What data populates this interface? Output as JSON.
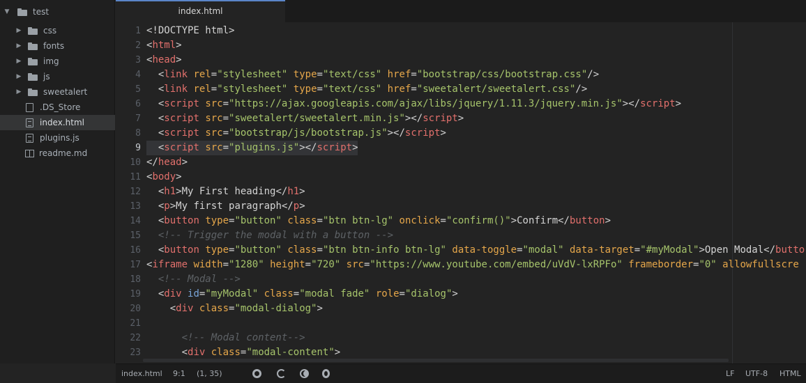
{
  "tree": {
    "root": "test",
    "folders": [
      "css",
      "fonts",
      "img",
      "js",
      "sweetalert"
    ],
    "files": [
      {
        "name": ".DS_Store",
        "selected": false
      },
      {
        "name": "index.html",
        "selected": true
      },
      {
        "name": "plugins.js",
        "selected": false
      },
      {
        "name": "readme.md",
        "selected": false
      }
    ]
  },
  "tabs": [
    {
      "label": "index.html",
      "active": true
    }
  ],
  "editor": {
    "cursor_line": 9,
    "lines": [
      [
        [
          "p",
          "<!DOCTYPE html>"
        ]
      ],
      [
        [
          "p",
          "<"
        ],
        [
          "t",
          "html"
        ],
        [
          "p",
          ">"
        ]
      ],
      [
        [
          "p",
          "<"
        ],
        [
          "t",
          "head"
        ],
        [
          "p",
          ">"
        ]
      ],
      [
        [
          "p",
          "  <"
        ],
        [
          "t",
          "link"
        ],
        [
          "p",
          " "
        ],
        [
          "a",
          "rel"
        ],
        [
          "p",
          "="
        ],
        [
          "s",
          "\"stylesheet\""
        ],
        [
          "p",
          " "
        ],
        [
          "a",
          "type"
        ],
        [
          "p",
          "="
        ],
        [
          "s",
          "\"text/css\""
        ],
        [
          "p",
          " "
        ],
        [
          "a",
          "href"
        ],
        [
          "p",
          "="
        ],
        [
          "s",
          "\"bootstrap/css/bootstrap.css\""
        ],
        [
          "p",
          "/>"
        ]
      ],
      [
        [
          "p",
          "  <"
        ],
        [
          "t",
          "link"
        ],
        [
          "p",
          " "
        ],
        [
          "a",
          "rel"
        ],
        [
          "p",
          "="
        ],
        [
          "s",
          "\"stylesheet\""
        ],
        [
          "p",
          " "
        ],
        [
          "a",
          "type"
        ],
        [
          "p",
          "="
        ],
        [
          "s",
          "\"text/css\""
        ],
        [
          "p",
          " "
        ],
        [
          "a",
          "href"
        ],
        [
          "p",
          "="
        ],
        [
          "s",
          "\"sweetalert/sweetalert.css\""
        ],
        [
          "p",
          "/>"
        ]
      ],
      [
        [
          "p",
          "  <"
        ],
        [
          "t",
          "script"
        ],
        [
          "p",
          " "
        ],
        [
          "a",
          "src"
        ],
        [
          "p",
          "="
        ],
        [
          "s",
          "\"https://ajax.googleapis.com/ajax/libs/jquery/1.11.3/jquery.min.js\""
        ],
        [
          "p",
          "></"
        ],
        [
          "t",
          "script"
        ],
        [
          "p",
          ">"
        ]
      ],
      [
        [
          "p",
          "  <"
        ],
        [
          "t",
          "script"
        ],
        [
          "p",
          " "
        ],
        [
          "a",
          "src"
        ],
        [
          "p",
          "="
        ],
        [
          "s",
          "\"sweetalert/sweetalert.min.js\""
        ],
        [
          "p",
          "></"
        ],
        [
          "t",
          "script"
        ],
        [
          "p",
          ">"
        ]
      ],
      [
        [
          "p",
          "  <"
        ],
        [
          "t",
          "script"
        ],
        [
          "p",
          " "
        ],
        [
          "a",
          "src"
        ],
        [
          "p",
          "="
        ],
        [
          "s",
          "\"bootstrap/js/bootstrap.js\""
        ],
        [
          "p",
          "></"
        ],
        [
          "t",
          "script"
        ],
        [
          "p",
          ">"
        ]
      ],
      [
        [
          "p",
          "  <"
        ],
        [
          "t",
          "script"
        ],
        [
          "p",
          " "
        ],
        [
          "a",
          "src"
        ],
        [
          "p",
          "="
        ],
        [
          "s",
          "\"plugins.js\""
        ],
        [
          "p",
          "></"
        ],
        [
          "t",
          "script"
        ],
        [
          "p",
          ">"
        ]
      ],
      [
        [
          "p",
          "</"
        ],
        [
          "t",
          "head"
        ],
        [
          "p",
          ">"
        ]
      ],
      [
        [
          "p",
          "<"
        ],
        [
          "t",
          "body"
        ],
        [
          "p",
          ">"
        ]
      ],
      [
        [
          "p",
          "  <"
        ],
        [
          "t",
          "h1"
        ],
        [
          "p",
          ">My First heading</"
        ],
        [
          "t",
          "h1"
        ],
        [
          "p",
          ">"
        ]
      ],
      [
        [
          "p",
          "  <"
        ],
        [
          "t",
          "p"
        ],
        [
          "p",
          ">My first paragraph</"
        ],
        [
          "t",
          "p"
        ],
        [
          "p",
          ">"
        ]
      ],
      [
        [
          "p",
          "  <"
        ],
        [
          "t",
          "button"
        ],
        [
          "p",
          " "
        ],
        [
          "a",
          "type"
        ],
        [
          "p",
          "="
        ],
        [
          "s",
          "\"button\""
        ],
        [
          "p",
          " "
        ],
        [
          "a",
          "class"
        ],
        [
          "p",
          "="
        ],
        [
          "s",
          "\"btn btn-lg\""
        ],
        [
          "p",
          " "
        ],
        [
          "a",
          "onclick"
        ],
        [
          "p",
          "="
        ],
        [
          "s",
          "\"confirm()\""
        ],
        [
          "p",
          ">Confirm</"
        ],
        [
          "t",
          "button"
        ],
        [
          "p",
          ">"
        ]
      ],
      [
        [
          "c",
          "  <!-- Trigger the modal with a button -->"
        ]
      ],
      [
        [
          "p",
          "  <"
        ],
        [
          "t",
          "button"
        ],
        [
          "p",
          " "
        ],
        [
          "a",
          "type"
        ],
        [
          "p",
          "="
        ],
        [
          "s",
          "\"button\""
        ],
        [
          "p",
          " "
        ],
        [
          "a",
          "class"
        ],
        [
          "p",
          "="
        ],
        [
          "s",
          "\"btn btn-info btn-lg\""
        ],
        [
          "p",
          " "
        ],
        [
          "a",
          "data-toggle"
        ],
        [
          "p",
          "="
        ],
        [
          "s",
          "\"modal\""
        ],
        [
          "p",
          " "
        ],
        [
          "a",
          "data-target"
        ],
        [
          "p",
          "="
        ],
        [
          "s",
          "\"#myModal\""
        ],
        [
          "p",
          ">Open Modal</"
        ],
        [
          "t",
          "butto"
        ]
      ],
      [
        [
          "p",
          "<"
        ],
        [
          "t",
          "iframe"
        ],
        [
          "p",
          " "
        ],
        [
          "a",
          "width"
        ],
        [
          "p",
          "="
        ],
        [
          "s",
          "\"1280\""
        ],
        [
          "p",
          " "
        ],
        [
          "a",
          "height"
        ],
        [
          "p",
          "="
        ],
        [
          "s",
          "\"720\""
        ],
        [
          "p",
          " "
        ],
        [
          "a",
          "src"
        ],
        [
          "p",
          "="
        ],
        [
          "s",
          "\"https://www.youtube.com/embed/uVdV-lxRPFo\""
        ],
        [
          "p",
          " "
        ],
        [
          "a",
          "frameborder"
        ],
        [
          "p",
          "="
        ],
        [
          "s",
          "\"0\""
        ],
        [
          "p",
          " "
        ],
        [
          "a",
          "allowfullscre"
        ]
      ],
      [
        [
          "c",
          "  <!-- Modal -->"
        ]
      ],
      [
        [
          "p",
          "  <"
        ],
        [
          "t",
          "div"
        ],
        [
          "p",
          " "
        ],
        [
          "id",
          "id"
        ],
        [
          "p",
          "="
        ],
        [
          "s",
          "\"myModal\""
        ],
        [
          "p",
          " "
        ],
        [
          "a",
          "class"
        ],
        [
          "p",
          "="
        ],
        [
          "s",
          "\"modal fade\""
        ],
        [
          "p",
          " "
        ],
        [
          "a",
          "role"
        ],
        [
          "p",
          "="
        ],
        [
          "s",
          "\"dialog\""
        ],
        [
          "p",
          ">"
        ]
      ],
      [
        [
          "p",
          "    <"
        ],
        [
          "t",
          "div"
        ],
        [
          "p",
          " "
        ],
        [
          "a",
          "class"
        ],
        [
          "p",
          "="
        ],
        [
          "s",
          "\"modal-dialog\""
        ],
        [
          "p",
          ">"
        ]
      ],
      [
        [
          "p",
          ""
        ]
      ],
      [
        [
          "c",
          "      <!-- Modal content-->"
        ]
      ],
      [
        [
          "p",
          "      <"
        ],
        [
          "t",
          "div"
        ],
        [
          "p",
          " "
        ],
        [
          "a",
          "class"
        ],
        [
          "p",
          "="
        ],
        [
          "s",
          "\"modal-content\""
        ],
        [
          "p",
          ">"
        ]
      ]
    ]
  },
  "status": {
    "file": "index.html",
    "cursor": "9:1",
    "selection": "(1, 35)",
    "browser_icons": [
      "chrome-icon",
      "ie-icon",
      "firefox-icon",
      "opera-icon"
    ],
    "line_ending": "LF",
    "encoding": "UTF-8",
    "grammar": "HTML"
  },
  "colors": {
    "tag": "#e2706c",
    "attribute": "#e6a74a",
    "id_attribute": "#7aa6da",
    "string": "#a6c46b",
    "comment": "#5e6266",
    "tab_accent": "#5a85c8"
  }
}
